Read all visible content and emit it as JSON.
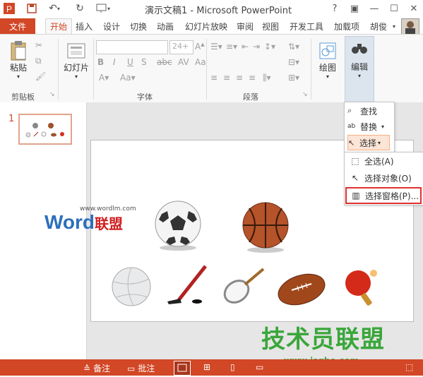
{
  "window": {
    "title": "演示文稿1 - Microsoft PowerPoint",
    "app_badge": "P"
  },
  "tabs": {
    "file": "文件",
    "items": [
      "开始",
      "插入",
      "设计",
      "切换",
      "动画",
      "幻灯片放映",
      "审阅",
      "视图",
      "开发工具",
      "加载项"
    ],
    "active_index": 0,
    "user": "胡俊"
  },
  "ribbon": {
    "clipboard": {
      "paste": "粘贴",
      "group": "剪贴板"
    },
    "slides": {
      "label": "幻灯片",
      "group": ""
    },
    "font": {
      "size_value": "24+",
      "group": "字体"
    },
    "paragraph": {
      "group": "段落"
    },
    "drawing": {
      "label": "绘图"
    },
    "editing": {
      "label": "编辑"
    }
  },
  "editing_panel": {
    "find": "查找",
    "replace": "替换",
    "select": "选择"
  },
  "select_menu": {
    "items": [
      "全选(A)",
      "选择对象(O)",
      "选择窗格(P)..."
    ]
  },
  "thumbnails": {
    "slide_number": "1"
  },
  "slide": {
    "watermark_url": "www.wordlm.com",
    "watermark_word": "Word",
    "watermark_cn": "联盟"
  },
  "overlay": {
    "site_cn": "技术员联盟",
    "site_url": "www.jsgho.com"
  },
  "statusbar": {
    "notes": "备注",
    "comments": "批注"
  },
  "colors": {
    "accent": "#d24726",
    "highlight_border": "#e03030",
    "overlay_green": "#3aa63a"
  }
}
